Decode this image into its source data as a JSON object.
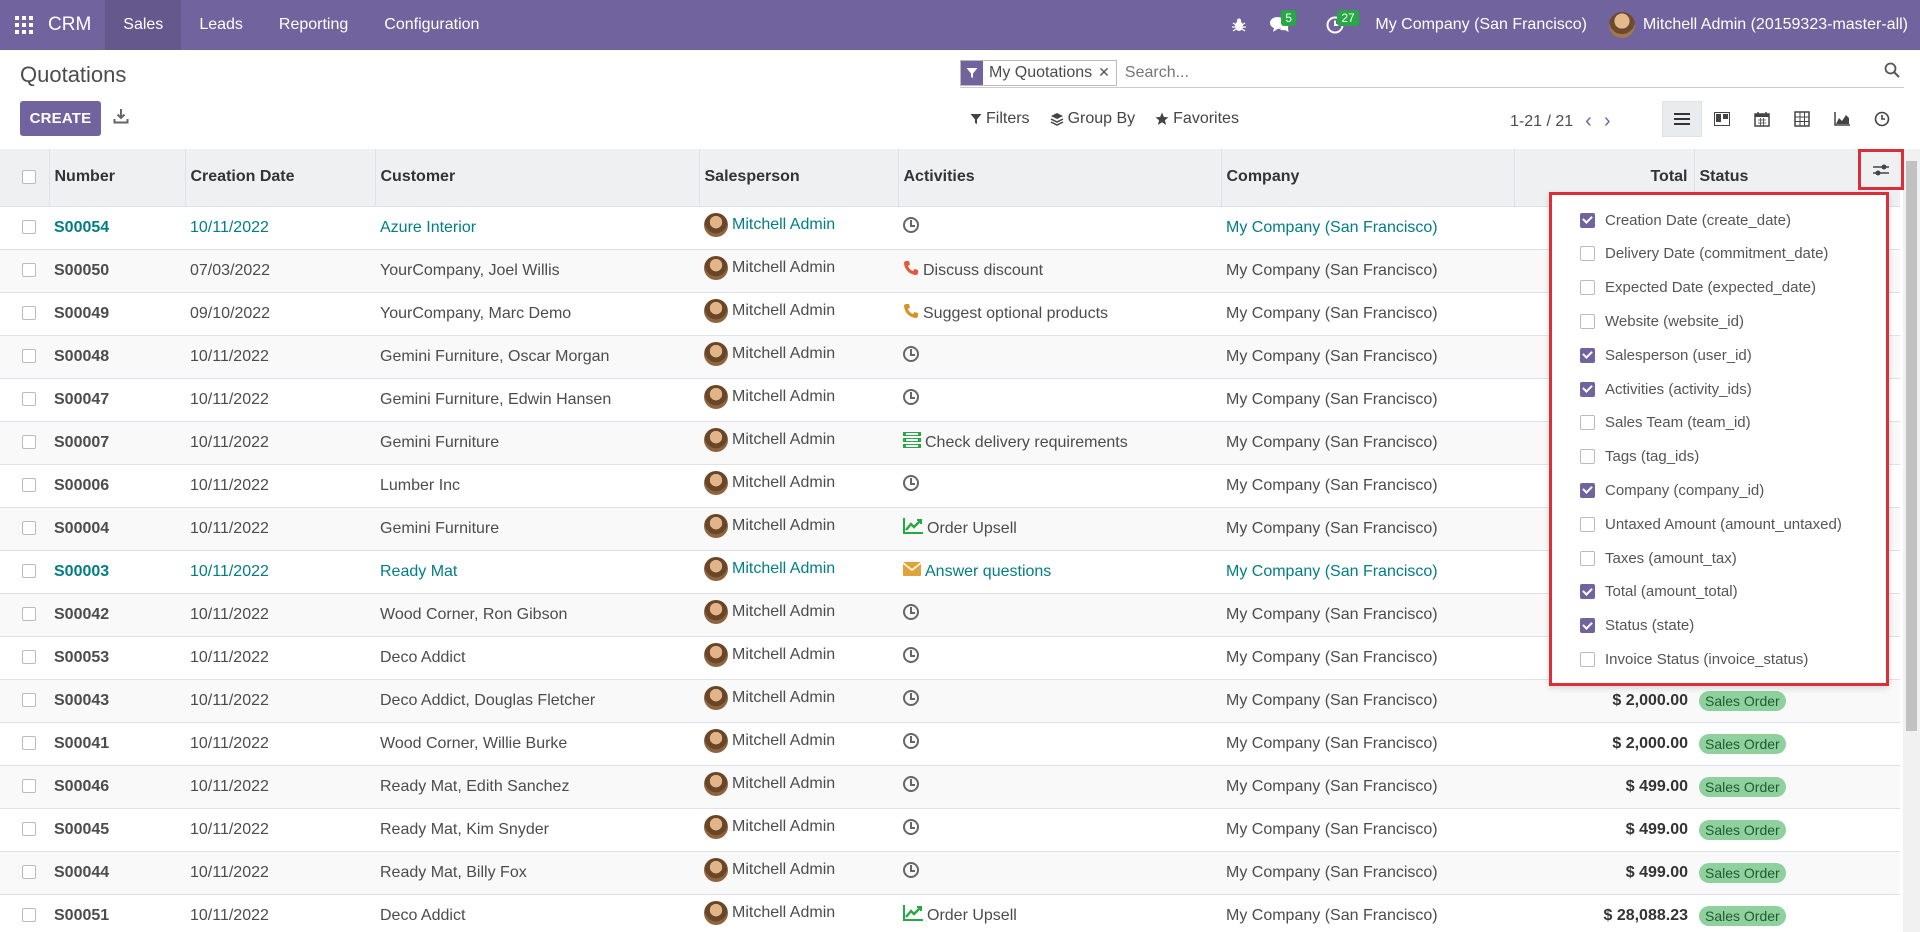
{
  "navbar": {
    "brand": "CRM",
    "menu": [
      "Sales",
      "Leads",
      "Reporting",
      "Configuration"
    ],
    "active_menu": "Sales",
    "messages_count": "5",
    "activities_count": "27",
    "company": "My Company (San Francisco)",
    "user": "Mitchell Admin (20159323-master-all)"
  },
  "control_panel": {
    "title": "Quotations",
    "facet_label": "My Quotations",
    "search_placeholder": "Search...",
    "create_label": "CREATE",
    "filters_label": "Filters",
    "groupby_label": "Group By",
    "favorites_label": "Favorites",
    "pager": "1-21 / 21"
  },
  "table": {
    "headers": {
      "number": "Number",
      "creation_date": "Creation Date",
      "customer": "Customer",
      "salesperson": "Salesperson",
      "activities": "Activities",
      "company": "Company",
      "total": "Total",
      "status": "Status"
    },
    "rows": [
      {
        "number": "S00054",
        "date": "10/11/2022",
        "customer": "Azure Interior",
        "salesperson": "Mitchell Admin",
        "activity": "",
        "activity_icon": "clock-icon",
        "company": "My Company (San Francisco)",
        "total": "",
        "status": ""
      },
      {
        "number": "S00050",
        "date": "07/03/2022",
        "customer": "YourCompany, Joel Willis",
        "salesperson": "Mitchell Admin",
        "activity": "Discuss discount",
        "activity_icon": "phone-icon",
        "company": "My Company (San Francisco)",
        "total": "",
        "status": ""
      },
      {
        "number": "S00049",
        "date": "09/10/2022",
        "customer": "YourCompany, Marc Demo",
        "salesperson": "Mitchell Admin",
        "activity": "Suggest optional products",
        "activity_icon": "phone-icon",
        "company": "My Company (San Francisco)",
        "total": "",
        "status": ""
      },
      {
        "number": "S00048",
        "date": "10/11/2022",
        "customer": "Gemini Furniture, Oscar Morgan",
        "salesperson": "Mitchell Admin",
        "activity": "",
        "activity_icon": "clock-icon",
        "company": "My Company (San Francisco)",
        "total": "",
        "status": ""
      },
      {
        "number": "S00047",
        "date": "10/11/2022",
        "customer": "Gemini Furniture, Edwin Hansen",
        "salesperson": "Mitchell Admin",
        "activity": "",
        "activity_icon": "clock-icon",
        "company": "My Company (San Francisco)",
        "total": "",
        "status": ""
      },
      {
        "number": "S00007",
        "date": "10/11/2022",
        "customer": "Gemini Furniture",
        "salesperson": "Mitchell Admin",
        "activity": "Check delivery requirements",
        "activity_icon": "tasks-icon",
        "company": "My Company (San Francisco)",
        "total": "",
        "status": ""
      },
      {
        "number": "S00006",
        "date": "10/11/2022",
        "customer": "Lumber Inc",
        "salesperson": "Mitchell Admin",
        "activity": "",
        "activity_icon": "clock-icon",
        "company": "My Company (San Francisco)",
        "total": "",
        "status": ""
      },
      {
        "number": "S00004",
        "date": "10/11/2022",
        "customer": "Gemini Furniture",
        "salesperson": "Mitchell Admin",
        "activity": "Order Upsell",
        "activity_icon": "chart-icon",
        "company": "My Company (San Francisco)",
        "total": "",
        "status": ""
      },
      {
        "number": "S00003",
        "date": "10/11/2022",
        "customer": "Ready Mat",
        "salesperson": "Mitchell Admin",
        "activity": "Answer questions",
        "activity_icon": "envelope-icon",
        "company": "My Company (San Francisco)",
        "total": "",
        "status": ""
      },
      {
        "number": "S00042",
        "date": "10/11/2022",
        "customer": "Wood Corner, Ron Gibson",
        "salesperson": "Mitchell Admin",
        "activity": "",
        "activity_icon": "clock-icon",
        "company": "My Company (San Francisco)",
        "total": "",
        "status": ""
      },
      {
        "number": "S00053",
        "date": "10/11/2022",
        "customer": "Deco Addict",
        "salesperson": "Mitchell Admin",
        "activity": "",
        "activity_icon": "clock-icon",
        "company": "My Company (San Francisco)",
        "total": "",
        "status": ""
      },
      {
        "number": "S00043",
        "date": "10/11/2022",
        "customer": "Deco Addict, Douglas Fletcher",
        "salesperson": "Mitchell Admin",
        "activity": "",
        "activity_icon": "clock-icon",
        "company": "My Company (San Francisco)",
        "total": "$ 2,000.00",
        "status": "Sales Order"
      },
      {
        "number": "S00041",
        "date": "10/11/2022",
        "customer": "Wood Corner, Willie Burke",
        "salesperson": "Mitchell Admin",
        "activity": "",
        "activity_icon": "clock-icon",
        "company": "My Company (San Francisco)",
        "total": "$ 2,000.00",
        "status": "Sales Order"
      },
      {
        "number": "S00046",
        "date": "10/11/2022",
        "customer": "Ready Mat, Edith Sanchez",
        "salesperson": "Mitchell Admin",
        "activity": "",
        "activity_icon": "clock-icon",
        "company": "My Company (San Francisco)",
        "total": "$ 499.00",
        "status": "Sales Order"
      },
      {
        "number": "S00045",
        "date": "10/11/2022",
        "customer": "Ready Mat, Kim Snyder",
        "salesperson": "Mitchell Admin",
        "activity": "",
        "activity_icon": "clock-icon",
        "company": "My Company (San Francisco)",
        "total": "$ 499.00",
        "status": "Sales Order"
      },
      {
        "number": "S00044",
        "date": "10/11/2022",
        "customer": "Ready Mat, Billy Fox",
        "salesperson": "Mitchell Admin",
        "activity": "",
        "activity_icon": "clock-icon",
        "company": "My Company (San Francisco)",
        "total": "$ 499.00",
        "status": "Sales Order"
      },
      {
        "number": "S00051",
        "date": "10/11/2022",
        "customer": "Deco Addict",
        "salesperson": "Mitchell Admin",
        "activity": "Order Upsell",
        "activity_icon": "chart-icon",
        "company": "My Company (San Francisco)",
        "total": "$ 28,088.23",
        "status": "Sales Order"
      }
    ]
  },
  "optional_columns": [
    {
      "label": "Creation Date (create_date)",
      "checked": true
    },
    {
      "label": "Delivery Date (commitment_date)",
      "checked": false
    },
    {
      "label": "Expected Date (expected_date)",
      "checked": false
    },
    {
      "label": "Website (website_id)",
      "checked": false
    },
    {
      "label": "Salesperson (user_id)",
      "checked": true
    },
    {
      "label": "Activities (activity_ids)",
      "checked": true
    },
    {
      "label": "Sales Team (team_id)",
      "checked": false
    },
    {
      "label": "Tags (tag_ids)",
      "checked": false
    },
    {
      "label": "Company (company_id)",
      "checked": true
    },
    {
      "label": "Untaxed Amount (amount_untaxed)",
      "checked": false
    },
    {
      "label": "Taxes (amount_tax)",
      "checked": false
    },
    {
      "label": "Total (amount_total)",
      "checked": true
    },
    {
      "label": "Status (state)",
      "checked": true
    },
    {
      "label": "Invoice Status (invoice_status)",
      "checked": false
    }
  ],
  "colors": {
    "navbar": "#71639e",
    "link": "#017e84",
    "badge_green": "#28a745",
    "status_badge": "#8fd19e",
    "highlight_red": "#d7303a"
  }
}
